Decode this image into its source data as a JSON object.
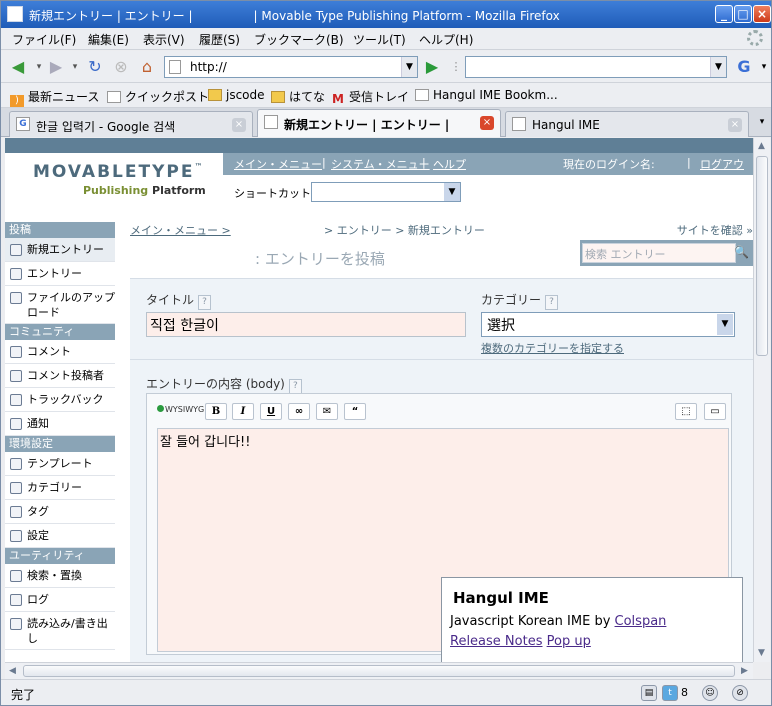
{
  "window": {
    "title": "新規エントリー | エントリー |                | Movable Type Publishing Platform - Mozilla Firefox"
  },
  "menu": [
    "ファイル(F)",
    "編集(E)",
    "表示(V)",
    "履歴(S)",
    "ブックマーク(B)",
    "ツール(T)",
    "ヘルプ(H)"
  ],
  "nav": {
    "url": "http://",
    "search": ""
  },
  "bookmarks": [
    "最新ニュース",
    "クイックポスト",
    "jscode",
    "はてな",
    "受信トレイ",
    "Hangul IME Bookm..."
  ],
  "tabs": [
    "한글 입력기 - Google 검색",
    "新規エントリー | エントリー |",
    "Hangul IME"
  ],
  "mt": {
    "logo_main": "MOVABLETYPE",
    "logo_tm": "™",
    "logo_sub1": "Publishing",
    "logo_sub2": "Platform",
    "topnav": [
      "メイン・メニュー",
      "システム・メニュー",
      "ヘルプ"
    ],
    "login": "現在のログイン名:",
    "logout": "ログアウト",
    "shortcut": "ショートカット:",
    "breadcrumb": [
      "メイン・メニュー >",
      "> エントリー > 新規エントリー"
    ],
    "site_confirm": "サイトを確認 »",
    "page_title": ": エントリーを投稿",
    "search_placeholder": "検索 エントリー",
    "title_label": "タイトル",
    "title_value": "직접 한글이",
    "category_label": "カテゴリー",
    "category_value": "選択",
    "multi_category": "複数のカテゴリーを指定する",
    "body_label": "エントリーの内容 (body)",
    "body_text": "잘 들어 갑니다!!",
    "wysiwyg": "WYSIWYG",
    "editor_buttons": [
      "B",
      "I",
      "U",
      "∞",
      "✉",
      "“"
    ],
    "sections": [
      {
        "title": "投稿",
        "items": [
          "新規エントリー",
          "エントリー",
          "ファイルのアップロード"
        ]
      },
      {
        "title": "コミュニティ",
        "items": [
          "コメント",
          "コメント投稿者",
          "トラックバック",
          "通知"
        ]
      },
      {
        "title": "環境設定",
        "items": [
          "テンプレート",
          "カテゴリー",
          "タグ",
          "設定"
        ]
      },
      {
        "title": "ユーティリティ",
        "items": [
          "検索・置換",
          "ログ",
          "読み込み/書き出し"
        ]
      }
    ]
  },
  "ime": {
    "heading": "Hangul IME",
    "desc_prefix": "Javascript Korean IME by",
    "author": "Colspan",
    "release": "Release Notes",
    "popup": "Pop up"
  },
  "status": {
    "text": "完了",
    "count": "8"
  }
}
